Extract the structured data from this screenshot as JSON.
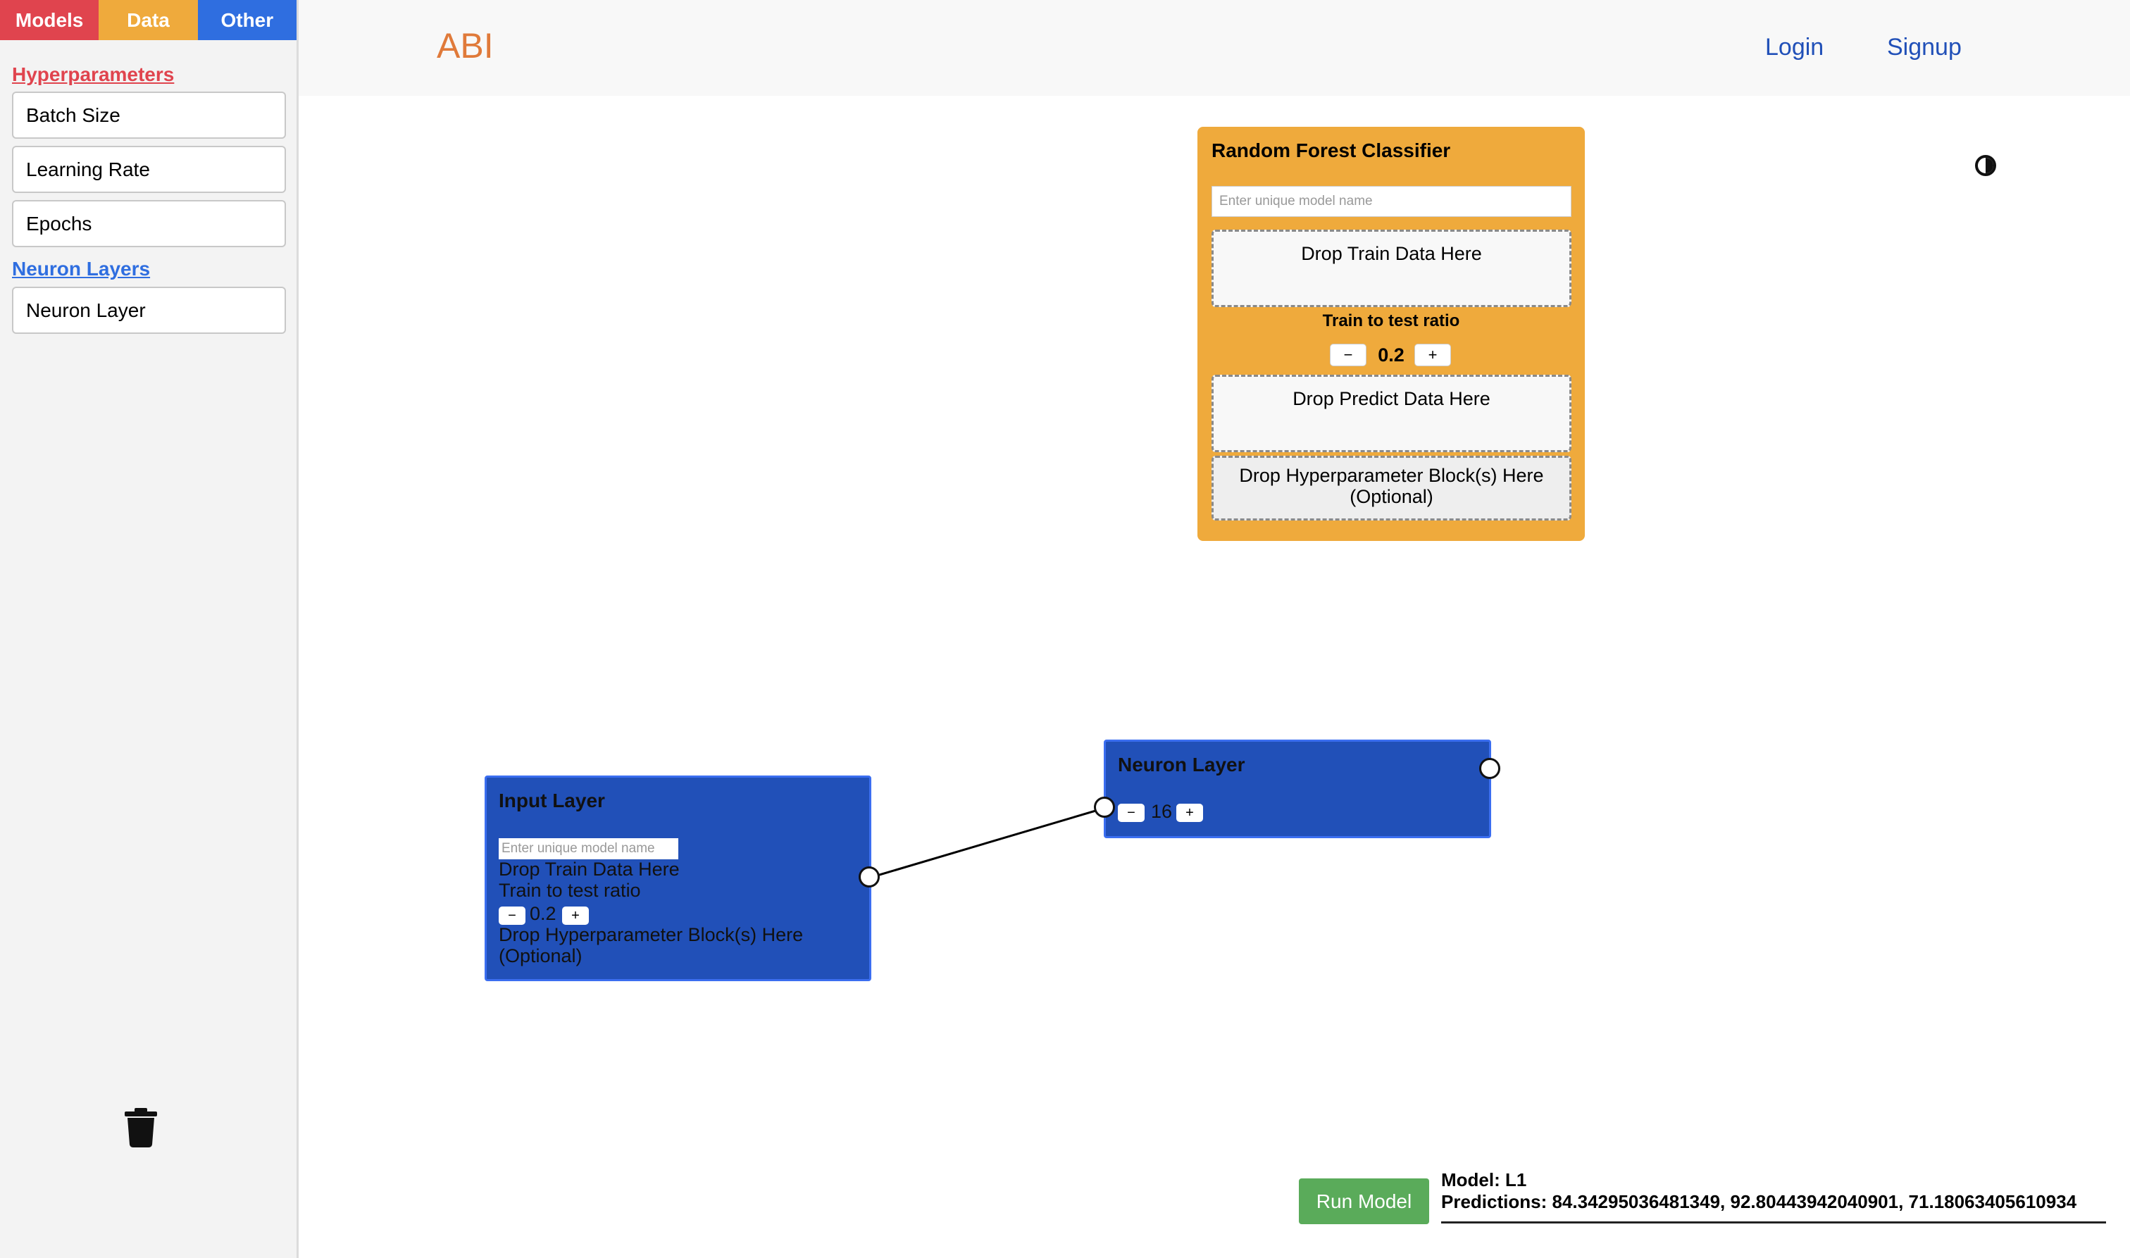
{
  "sidebar": {
    "tabs": [
      {
        "label": "Models",
        "color": "#e0444e"
      },
      {
        "label": "Data",
        "color": "#efaa3c"
      },
      {
        "label": "Other",
        "color": "#2f6ee0"
      }
    ],
    "hyperparameters_title": "Hyperparameters",
    "hyperparameters": [
      "Batch Size",
      "Learning Rate",
      "Epochs"
    ],
    "neuron_layers_title": "Neuron Layers",
    "neuron_layers": [
      "Neuron Layer"
    ],
    "trash_icon": "trash-icon"
  },
  "header": {
    "brand": "ABI",
    "login": "Login",
    "signup": "Signup"
  },
  "random_forest": {
    "title": "Random Forest Classifier",
    "name_placeholder": "Enter unique model name",
    "drop_train": "Drop Train Data Here",
    "ratio_label": "Train to test ratio",
    "minus": "−",
    "ratio_value": "0.2",
    "plus": "+",
    "drop_predict": "Drop Predict Data Here",
    "drop_hyper_line1": "Drop Hyperparameter Block(s) Here",
    "drop_hyper_line2": "(Optional)"
  },
  "input_layer": {
    "title": "Input Layer",
    "name_placeholder": "Enter unique model name",
    "drop_train": "Drop Train Data Here",
    "ratio_label": "Train to test ratio",
    "minus": "−",
    "ratio_value": "0.2",
    "plus": "+",
    "drop_hyper_line1": "Drop Hyperparameter Block(s) Here",
    "drop_hyper_line2": "(Optional)"
  },
  "neuron_layer_node": {
    "title": "Neuron Layer",
    "minus": "−",
    "value": "16",
    "plus": "+"
  },
  "run": {
    "button": "Run Model",
    "model_line": "Model: L1",
    "predictions_line": "Predictions: 84.34295036481349, 92.80443942040901, 71.18063405610934"
  }
}
